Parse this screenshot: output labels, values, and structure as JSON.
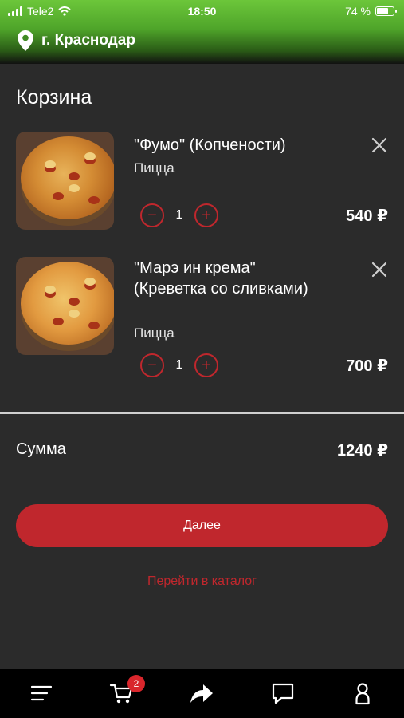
{
  "status": {
    "carrier": "Tele2",
    "time": "18:50",
    "battery": "74 %",
    "battery_level": 0.74
  },
  "location": {
    "city": "г. Краснодар",
    "icon": "location-pin-icon"
  },
  "page": {
    "title": "Корзина"
  },
  "cart": {
    "items": [
      {
        "name": "\"Фумо\" (Копчености)",
        "category": "Пицца",
        "quantity": "1",
        "price": "540 ₽"
      },
      {
        "name": "\"Марэ ин крема\" (Креветка со сливками)",
        "category": "Пицца",
        "quantity": "1",
        "price": "700 ₽"
      }
    ],
    "minus_symbol": "−",
    "plus_symbol": "+"
  },
  "summary": {
    "label": "Сумма",
    "value": "1240 ₽"
  },
  "actions": {
    "next_label": "Далее",
    "catalog_label": "Перейти в каталог"
  },
  "tabbar": {
    "cart_badge": "2",
    "icons": [
      "menu-icon",
      "cart-icon",
      "share-icon",
      "chat-icon",
      "profile-icon"
    ]
  },
  "colors": {
    "accent": "#c0272d",
    "background": "#2b2b2b",
    "tabbar": "#000000",
    "header_green": "#5cb531"
  }
}
